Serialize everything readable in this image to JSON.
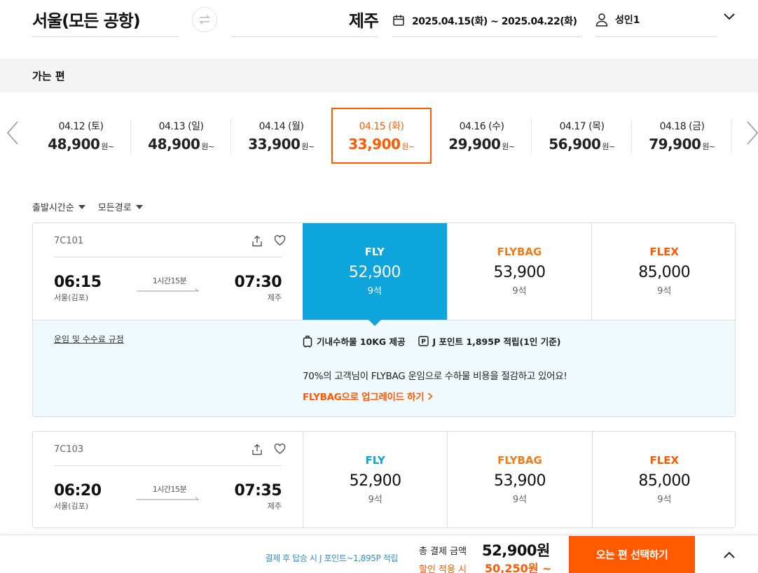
{
  "search": {
    "origin": "서울(모든 공항)",
    "destination": "제주",
    "dates": "2025.04.15(화) ~ 2025.04.22(화)",
    "passengers": "성인1"
  },
  "section_title": "가는 편",
  "carousel": {
    "currency_suffix": "원~",
    "days": [
      {
        "date": "04.12 (토)",
        "price": "48,900",
        "active": false
      },
      {
        "date": "04.13 (일)",
        "price": "48,900",
        "active": false
      },
      {
        "date": "04.14 (월)",
        "price": "33,900",
        "active": false
      },
      {
        "date": "04.15 (화)",
        "price": "33,900",
        "active": true
      },
      {
        "date": "04.16 (수)",
        "price": "29,900",
        "active": false
      },
      {
        "date": "04.17 (목)",
        "price": "56,900",
        "active": false
      },
      {
        "date": "04.18 (금)",
        "price": "79,900",
        "active": false
      }
    ]
  },
  "filters": {
    "sort": "출발시간순",
    "route": "모든경로"
  },
  "flights": [
    {
      "flight_no": "7C101",
      "dep_time": "06:15",
      "dep_city": "서울(김포)",
      "duration": "1시간15분",
      "arr_time": "07:30",
      "arr_city": "제주",
      "fares": [
        {
          "name": "FLY",
          "price": "52,900",
          "seats": "9석"
        },
        {
          "name": "FLYBAG",
          "price": "53,900",
          "seats": "9석"
        },
        {
          "name": "FLEX",
          "price": "85,000",
          "seats": "9석"
        }
      ]
    },
    {
      "flight_no": "7C103",
      "dep_time": "06:20",
      "dep_city": "서울(김포)",
      "duration": "1시간15분",
      "arr_time": "07:35",
      "arr_city": "제주",
      "fares": [
        {
          "name": "FLY",
          "price": "52,900",
          "seats": "9석"
        },
        {
          "name": "FLYBAG",
          "price": "53,900",
          "seats": "9석"
        },
        {
          "name": "FLEX",
          "price": "85,000",
          "seats": "9석"
        }
      ]
    }
  ],
  "detail": {
    "rules_link": "운임 및 수수료 규정",
    "baggage": "기내수하물 10KG 제공",
    "points": "J 포인트 1,895P 적립(1인 기준)",
    "promo": "70%의 고객님이 FLYBAG 운임으로 수하물 비용을 절감하고 있어요!",
    "upgrade": "FLYBAG으로 업그레이드 하기"
  },
  "bottom": {
    "earn": "결제 후 탑승 시 J 포인트~1,895P 적립",
    "total_label": "총 결제 금액",
    "total_value": "52,900원",
    "discount_label": "할인 적용 시",
    "discount_value": "50,250원 ~",
    "cta": "오는 편 선택하기"
  },
  "colors": {
    "accent": "#ff5a00",
    "selected_fare": "#0ea5dd",
    "fly": "#0ea5dd",
    "flybag": "#f07b1a",
    "flex": "#ff5a00",
    "earn_text": "#2f8fd6"
  },
  "icons": [
    "swap-icon",
    "calendar-icon",
    "person-icon",
    "chevron-down-icon",
    "chevron-left-icon",
    "chevron-right-icon",
    "share-icon",
    "heart-icon",
    "luggage-icon",
    "points-icon",
    "chevron-up-icon"
  ]
}
